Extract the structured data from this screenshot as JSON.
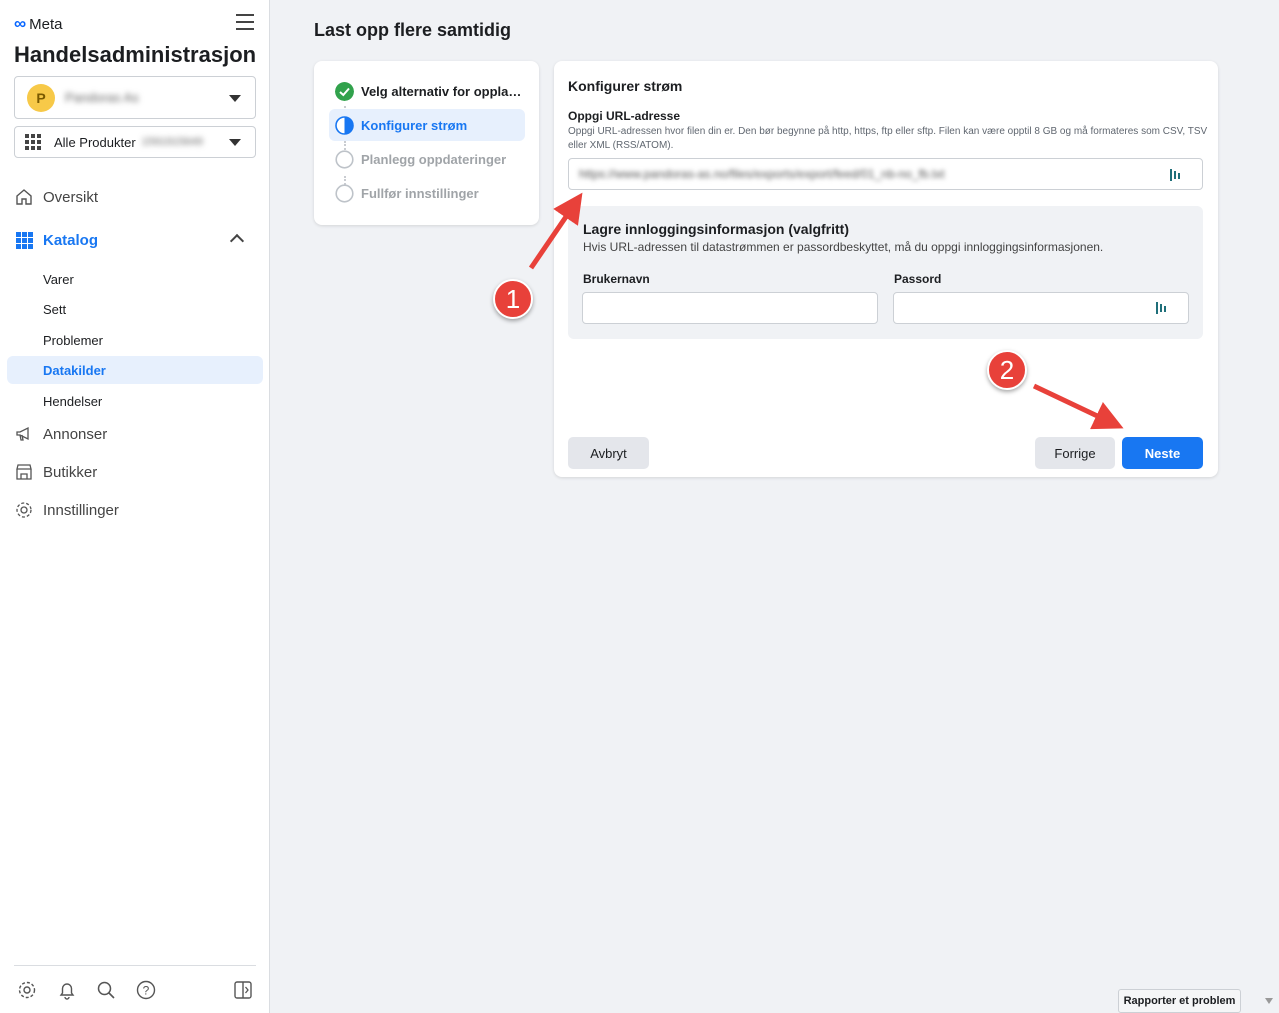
{
  "sidebar": {
    "brand": "Meta",
    "app_title": "Handelsadministrasjon",
    "business": {
      "avatar_letter": "P",
      "name": "Pandoras As"
    },
    "catalog": {
      "label": "Alle Produkter",
      "id": "1591915649"
    },
    "nav": [
      {
        "label": "Oversikt",
        "icon": "home-icon"
      },
      {
        "label": "Katalog",
        "icon": "grid-icon",
        "expanded": true
      },
      {
        "label": "Annonser",
        "icon": "megaphone-icon"
      },
      {
        "label": "Butikker",
        "icon": "store-icon"
      },
      {
        "label": "Innstillinger",
        "icon": "gear-icon"
      }
    ],
    "catalog_sub": [
      "Varer",
      "Sett",
      "Problemer",
      "Datakilder",
      "Hendelser"
    ],
    "active_sub": "Datakilder",
    "footer_icons": [
      "gear-icon",
      "bell-icon",
      "search-icon",
      "help-icon",
      "panel-icon"
    ]
  },
  "main": {
    "title": "Last opp flere samtidig",
    "steps": [
      {
        "label": "Velg alternativ for opplasting",
        "status": "done"
      },
      {
        "label": "Konfigurer strøm",
        "status": "current"
      },
      {
        "label": "Planlegg oppdateringer",
        "status": "todo"
      },
      {
        "label": "Fullfør innstillinger",
        "status": "todo"
      }
    ],
    "config": {
      "title": "Konfigurer strøm",
      "url_label": "Oppgi URL-adresse",
      "url_help": "Oppgi URL-adressen hvor filen din er. Den bør begynne på http, https, ftp eller sftp. Filen kan være opptil 8 GB og må formateres som CSV, TSV eller XML (RSS/ATOM).",
      "url_value": "https://www.pandoras-as.no/files/exports/export/feed/01_nb-no_fb.txt",
      "login_title": "Lagre innloggingsinformasjon (valgfritt)",
      "login_desc": "Hvis URL-adressen til datastrømmen er passordbeskyttet, må du oppgi innloggingsinformasjonen.",
      "username_label": "Brukernavn",
      "password_label": "Passord",
      "cancel": "Avbryt",
      "previous": "Forrige",
      "next": "Neste"
    }
  },
  "annotations": {
    "badge1": "1",
    "badge2": "2",
    "color": "#e8413a"
  },
  "report_problem": "Rapporter et problem",
  "colors": {
    "accent": "#1877f2",
    "success": "#31a24c",
    "annotation": "#e8413a"
  }
}
